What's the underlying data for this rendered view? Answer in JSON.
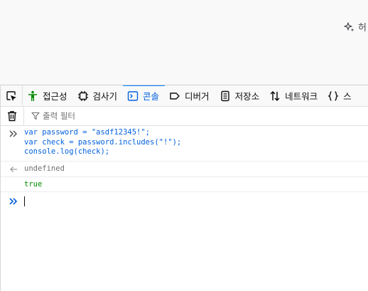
{
  "page": {
    "ai_button_label": "허"
  },
  "devtools": {
    "tabs": [
      {
        "label": "접근성",
        "icon": "accessibility-icon",
        "selected": false
      },
      {
        "label": "검사기",
        "icon": "inspector-icon",
        "selected": false
      },
      {
        "label": "콘솔",
        "icon": "console-icon",
        "selected": true
      },
      {
        "label": "디버거",
        "icon": "debugger-icon",
        "selected": false
      },
      {
        "label": "저장소",
        "icon": "storage-icon",
        "selected": false
      },
      {
        "label": "네트워크",
        "icon": "network-icon",
        "selected": false
      },
      {
        "label": "스",
        "icon": "style-editor-icon",
        "selected": false
      }
    ],
    "filter": {
      "placeholder": "출력 필터"
    },
    "console": {
      "input_lines": [
        "var password = \"asdf12345!\";",
        "var check = password.includes(\"!\");",
        "console.log(check);"
      ],
      "return_value": "undefined",
      "log_output": "true"
    }
  },
  "colors": {
    "accent": "#0060df",
    "selected_tab_bar": "#0a84ff",
    "log_true": "#058b00",
    "muted": "#737373"
  }
}
